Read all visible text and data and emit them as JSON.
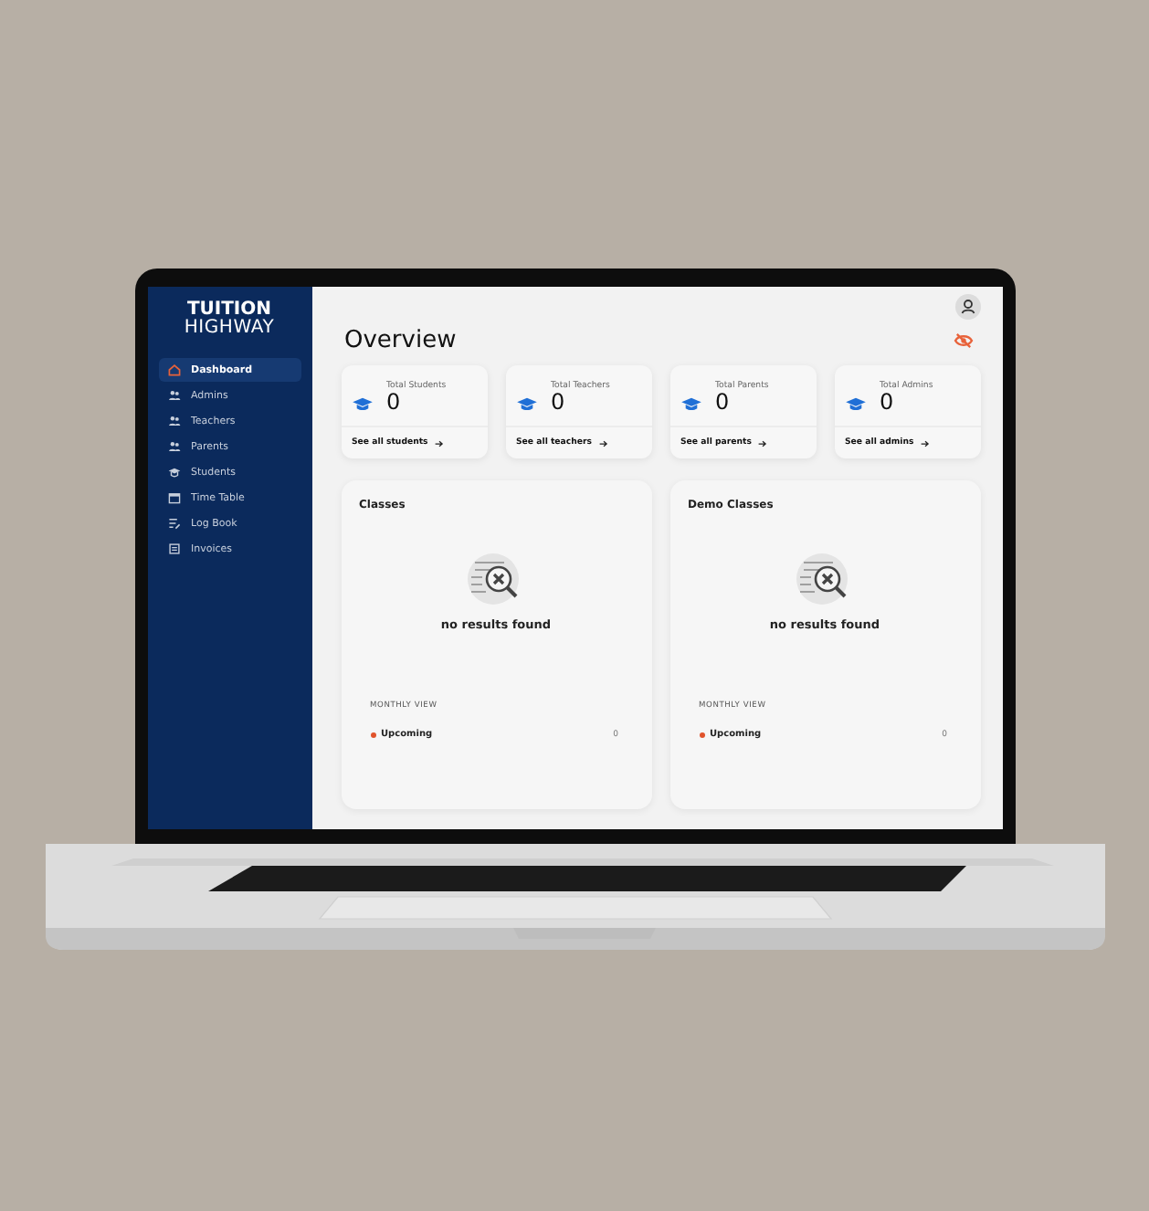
{
  "logo": {
    "line1": "TUITION",
    "line2": "HIGHWAY"
  },
  "sidebar": {
    "items": [
      {
        "label": "Dashboard",
        "selected": true
      },
      {
        "label": "Admins",
        "selected": false
      },
      {
        "label": "Teachers",
        "selected": false
      },
      {
        "label": "Parents",
        "selected": false
      },
      {
        "label": "Students",
        "selected": false
      },
      {
        "label": "Time Table",
        "selected": false
      },
      {
        "label": "Log Book",
        "selected": false
      },
      {
        "label": "Invoices",
        "selected": false
      }
    ]
  },
  "heading": "Overview",
  "stats": [
    {
      "label": "Total Students",
      "value": "0",
      "link": "See all students"
    },
    {
      "label": "Total Teachers",
      "value": "0",
      "link": "See all teachers"
    },
    {
      "label": "Total Parents",
      "value": "0",
      "link": "See all parents"
    },
    {
      "label": "Total Admins",
      "value": "0",
      "link": "See all admins"
    }
  ],
  "panels": [
    {
      "title": "Classes",
      "empty_text": "no results found",
      "section": "MONTHLY VIEW",
      "rows": [
        {
          "label": "Upcoming",
          "count": "0",
          "color": "#e0532b"
        }
      ]
    },
    {
      "title": "Demo Classes",
      "empty_text": "no results found",
      "section": "MONTHLY VIEW",
      "rows": [
        {
          "label": "Upcoming",
          "count": "0",
          "color": "#e0532b"
        }
      ]
    }
  ]
}
